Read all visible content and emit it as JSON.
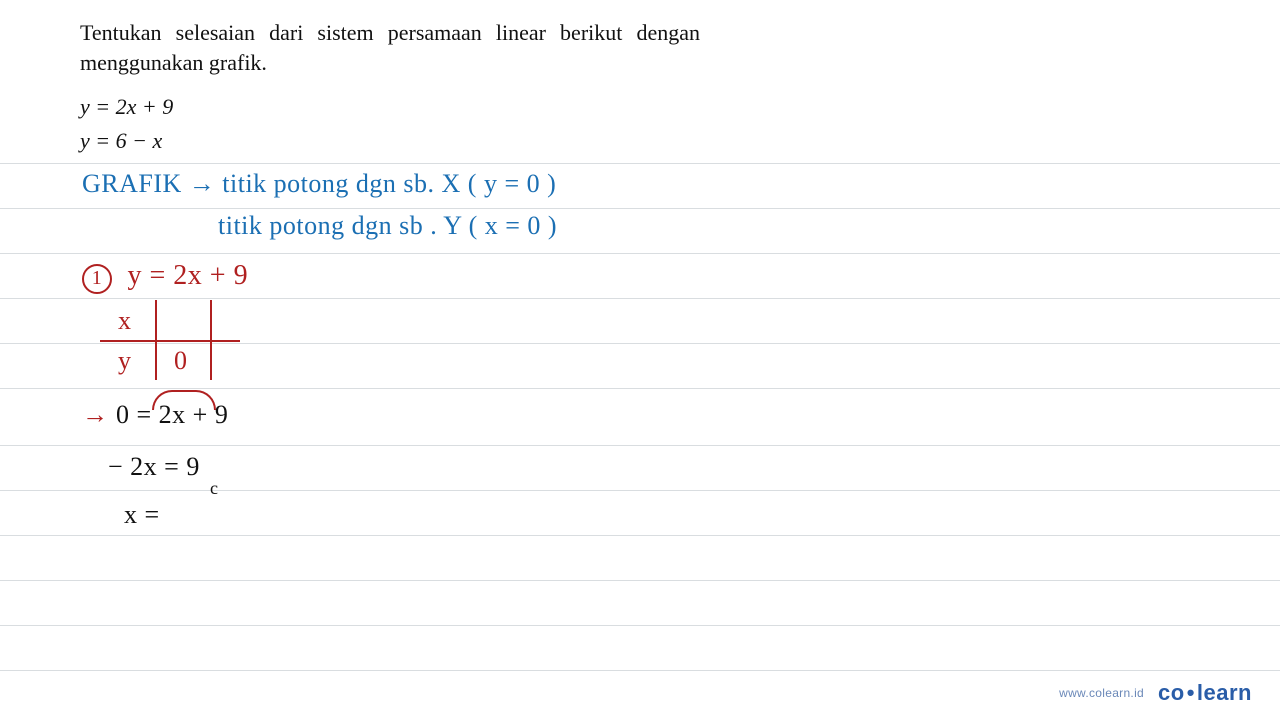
{
  "problem": {
    "text": "Tentukan selesaian dari sistem persamaan linear berikut dengan menggunakan grafik.",
    "eq1": "y = 2x + 9",
    "eq2": "y = 6 − x"
  },
  "notes": {
    "grafik_line1": "GRAFIK  →  titik  potong  dgn  sb. X ( y = 0 )",
    "grafik_line2": "titik  potong  dgn  sb . Y ( x = 0 )",
    "step1_label": "1",
    "step1_eq": "y = 2x + 9",
    "table": {
      "x": "x",
      "y": "y",
      "zero": "0"
    },
    "arrow": "→",
    "eq_a": "0 = 2x + 9",
    "eq_b": "− 2x  =  9",
    "eq_b_sub": "c",
    "eq_c": "x ="
  },
  "footer": {
    "url": "www.colearn.id",
    "logo_left": "co",
    "logo_dot": "•",
    "logo_right": "learn"
  },
  "rules_top": [
    163,
    208,
    253,
    298,
    343,
    388,
    445,
    490,
    535,
    580,
    625,
    670
  ]
}
